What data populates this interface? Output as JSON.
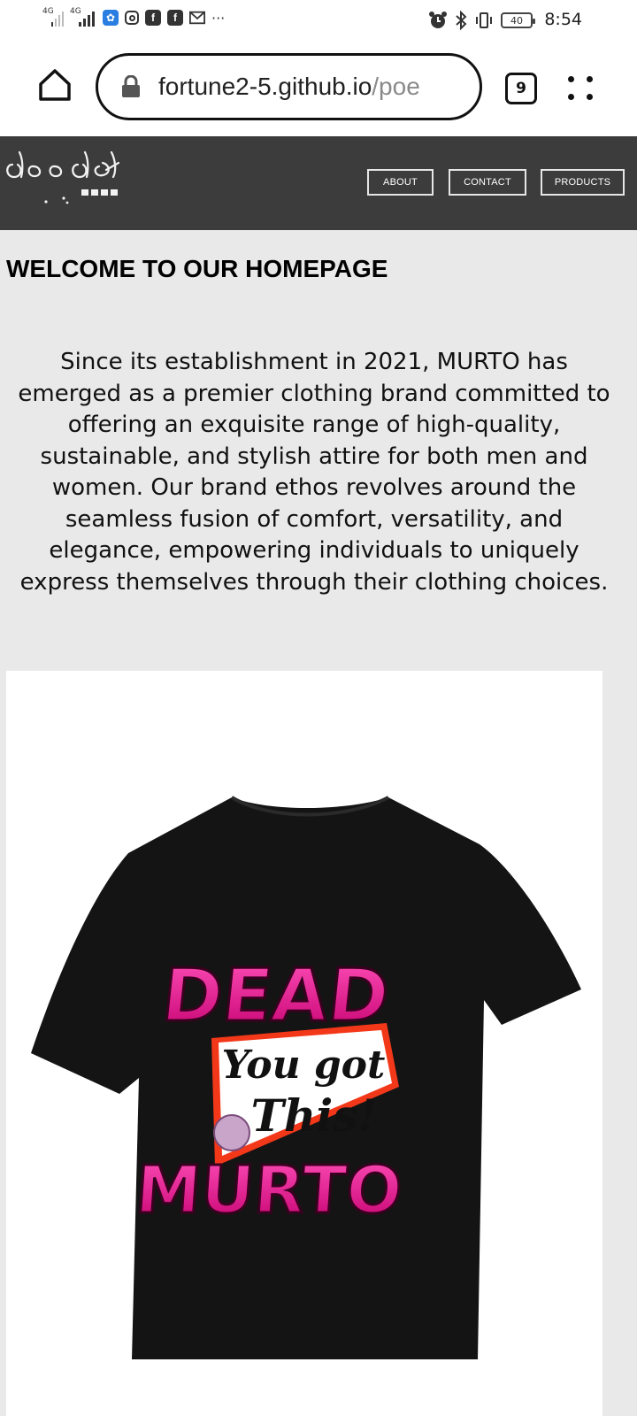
{
  "status_bar": {
    "network_1": "4G",
    "network_2": "4G",
    "more": "···",
    "battery": "40",
    "time": "8:54"
  },
  "browser": {
    "url_host": "fortune2-5.github.io",
    "url_path": "/poe",
    "tab_count": "9"
  },
  "site": {
    "logo_icon": "doodle-logo-icon",
    "nav": [
      {
        "label": "ABOUT"
      },
      {
        "label": "CONTACT"
      },
      {
        "label": "PRODUCTS"
      }
    ]
  },
  "main": {
    "heading": "WELCOME TO OUR HOMEPAGE",
    "about_lines": [
      "Since its establishment in 2021, MURTO has",
      "emerged as a premier clothing brand committed to",
      "offering an exquisite range of high-quality,",
      "sustainable, and stylish attire for both men and",
      "women. Our brand ethos revolves around the",
      "seamless fusion of comfort, versatility, and",
      "elegance, empowering individuals to uniquely",
      "express themselves through their clothing choices."
    ],
    "product": {
      "print_top": "DEAD",
      "print_mid_1": "You got",
      "print_mid_2": "This!",
      "print_bottom": "MURTO"
    }
  },
  "colors": {
    "header_bg": "#3c3c3c",
    "page_bg": "#e9e9e9",
    "print_pink": "#e8168f"
  }
}
